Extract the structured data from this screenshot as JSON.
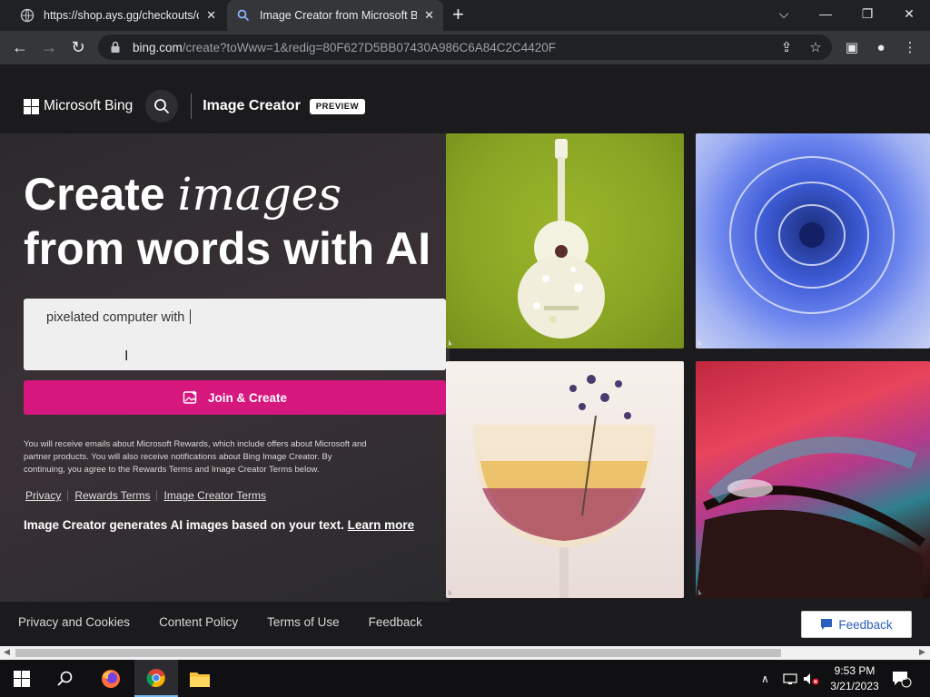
{
  "browser": {
    "tabs": [
      {
        "title": "https://shop.ays.gg/checkouts/c/"
      },
      {
        "title": "Image Creator from Microsoft Bing"
      }
    ],
    "url_host": "bing.com",
    "url_path": "/create?toWww=1&redig=80F627D5BB07430A986C6A84C2C4420F"
  },
  "header": {
    "brand": "Microsoft Bing",
    "product": "Image Creator",
    "badge": "PREVIEW"
  },
  "hero": {
    "headline_part1": "Create ",
    "headline_italic": "images",
    "headline_part2": " from words with AI"
  },
  "prompt": {
    "value": "pixelated computer with "
  },
  "cta": {
    "label": "Join & Create"
  },
  "disclaimer": "You will receive emails about Microsoft Rewards, which include offers about Microsoft and partner products. You will also receive notifications about Bing Image Creator. By continuing, you agree to the Rewards Terms and Image Creator Terms below.",
  "links": {
    "privacy": "Privacy",
    "rewards_terms": "Rewards Terms",
    "image_creator_terms": "Image Creator Terms"
  },
  "tagline": {
    "text": "Image Creator generates AI images based on your text. ",
    "learn_more": "Learn more"
  },
  "footer": {
    "links": [
      "Privacy and Cookies",
      "Content Policy",
      "Terms of Use",
      "Feedback"
    ],
    "feedback_button": "Feedback"
  },
  "taskbar": {
    "time": "9:53 PM",
    "date": "3/21/2023",
    "notification_count": "1"
  },
  "colors": {
    "accent": "#d6177e",
    "page_bg": "#1b1a1c"
  }
}
